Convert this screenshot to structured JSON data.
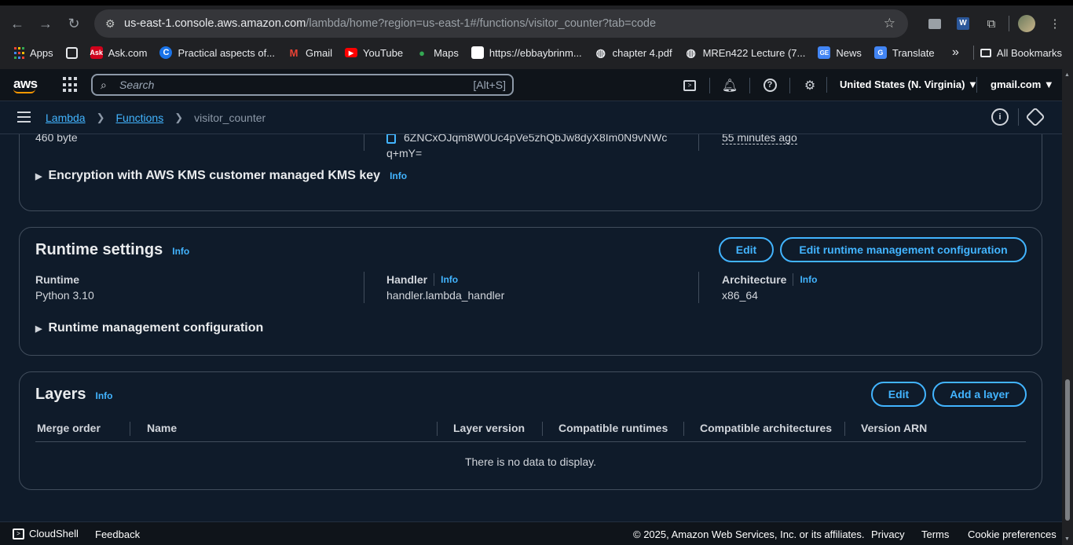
{
  "browser": {
    "url_host": "us-east-1.console.aws.amazon.com",
    "url_path": "/lambda/home?region=us-east-1#/functions/visitor_counter?tab=code",
    "bookmarks": [
      {
        "label": "Apps",
        "icon": "apps-icon"
      },
      {
        "label": "",
        "icon": "grid-icon"
      },
      {
        "label": "Ask.com",
        "icon": "ask-icon"
      },
      {
        "label": "Practical aspects of...",
        "icon": "c-icon"
      },
      {
        "label": "Gmail",
        "icon": "gmail-icon"
      },
      {
        "label": "YouTube",
        "icon": "youtube-icon"
      },
      {
        "label": "Maps",
        "icon": "maps-icon"
      },
      {
        "label": "https://ebbaybrinm...",
        "icon": "page-icon"
      },
      {
        "label": "chapter 4.pdf",
        "icon": "globe-icon"
      },
      {
        "label": "MREn422 Lecture (7...",
        "icon": "globe-icon"
      },
      {
        "label": "News",
        "icon": "news-icon"
      },
      {
        "label": "Translate",
        "icon": "translate-icon"
      }
    ],
    "all_bookmarks": "All Bookmarks",
    "more": "»"
  },
  "aws_header": {
    "logo": "aws",
    "search_placeholder": "Search",
    "search_shortcut": "[Alt+S]",
    "region": "United States (N. Virginia) ▼",
    "account": "gmail.com ▼"
  },
  "breadcrumb": {
    "items": [
      "Lambda",
      "Functions"
    ],
    "current": "visitor_counter"
  },
  "code_properties": {
    "size": "460 byte",
    "sha_line1": "6ZNCxOJqm8W0Uc4pVe5zhQbJw8dyX8Im0N9vNWc",
    "sha_line2": "q+mY=",
    "last_modified": "55 minutes ago",
    "encryption_label": "Encryption with AWS KMS customer managed KMS key",
    "info": "Info"
  },
  "runtime_settings": {
    "title": "Runtime settings",
    "info": "Info",
    "edit": "Edit",
    "edit_runtime_mgmt": "Edit runtime management configuration",
    "runtime_label": "Runtime",
    "runtime_value": "Python 3.10",
    "handler_label": "Handler",
    "handler_value": "handler.lambda_handler",
    "arch_label": "Architecture",
    "arch_value": "x86_64",
    "runtime_mgmt_label": "Runtime management configuration"
  },
  "layers": {
    "title": "Layers",
    "info": "Info",
    "edit": "Edit",
    "add": "Add a layer",
    "columns": [
      "Merge order",
      "Name",
      "Layer version",
      "Compatible runtimes",
      "Compatible architectures",
      "Version ARN"
    ],
    "empty": "There is no data to display."
  },
  "footer": {
    "cloudshell": "CloudShell",
    "feedback": "Feedback",
    "copyright": "© 2025, Amazon Web Services, Inc. or its affiliates.",
    "privacy": "Privacy",
    "terms": "Terms",
    "cookies": "Cookie preferences"
  },
  "colors": {
    "link": "#42b4ff",
    "page_bg": "#0f1b2a",
    "header_bg": "#0f141a"
  }
}
